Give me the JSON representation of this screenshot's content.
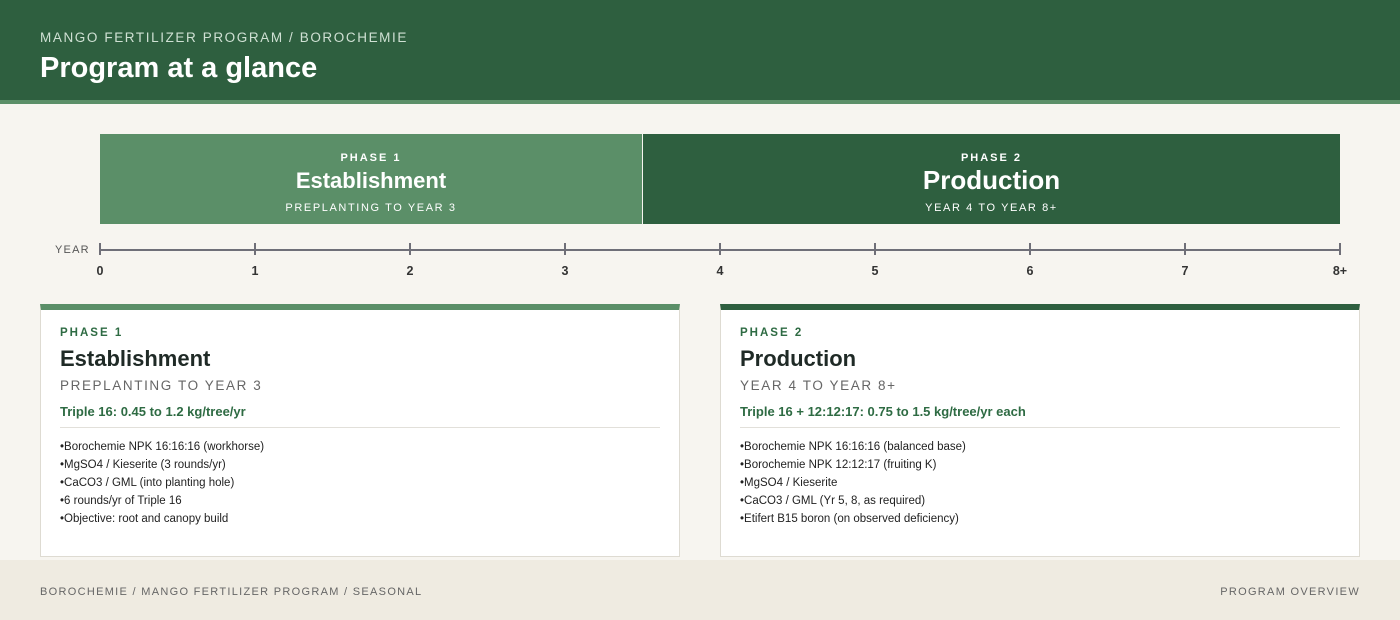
{
  "header": {
    "eyebrow": "MANGO FERTILIZER PROGRAM / BOROCHEMIE",
    "title": "Program at a glance"
  },
  "bands": [
    {
      "kicker": "PHASE 1",
      "name": "Establishment",
      "range": "PREPLANTING TO YEAR 3"
    },
    {
      "kicker": "PHASE 2",
      "name": "Production",
      "range": "YEAR 4 TO YEAR 8+"
    }
  ],
  "timeline": {
    "label": "YEAR",
    "ticks": [
      "0",
      "1",
      "2",
      "3",
      "4",
      "5",
      "6",
      "7",
      "8+"
    ]
  },
  "cards": [
    {
      "kicker": "PHASE 1",
      "name": "Establishment",
      "range": "PREPLANTING TO YEAR 3",
      "rate": "Triple 16: 0.45 to 1.2 kg/tree/yr",
      "items": [
        "Borochemie NPK 16:16:16 (workhorse)",
        "MgSO4 / Kieserite (3 rounds/yr)",
        "CaCO3 / GML (into planting hole)",
        "6 rounds/yr of Triple 16",
        "Objective: root and canopy build"
      ]
    },
    {
      "kicker": "PHASE 2",
      "name": "Production",
      "range": "YEAR 4 TO YEAR 8+",
      "rate": "Triple 16 + 12:12:17: 0.75 to 1.5 kg/tree/yr each",
      "items": [
        "Borochemie NPK 16:16:16 (balanced base)",
        "Borochemie NPK 12:12:17 (fruiting K)",
        "MgSO4 / Kieserite",
        "CaCO3 / GML (Yr 5, 8, as required)",
        "Etifert B15 boron (on observed deficiency)"
      ]
    }
  ],
  "footer": {
    "left": "BOROCHEMIE / MANGO FERTILIZER PROGRAM / SEASONAL",
    "right": "PROGRAM OVERVIEW"
  },
  "colors": {
    "phase1": "#5b8f68",
    "phase2": "#2e5f3f",
    "accent_text": "#2e6b43"
  }
}
